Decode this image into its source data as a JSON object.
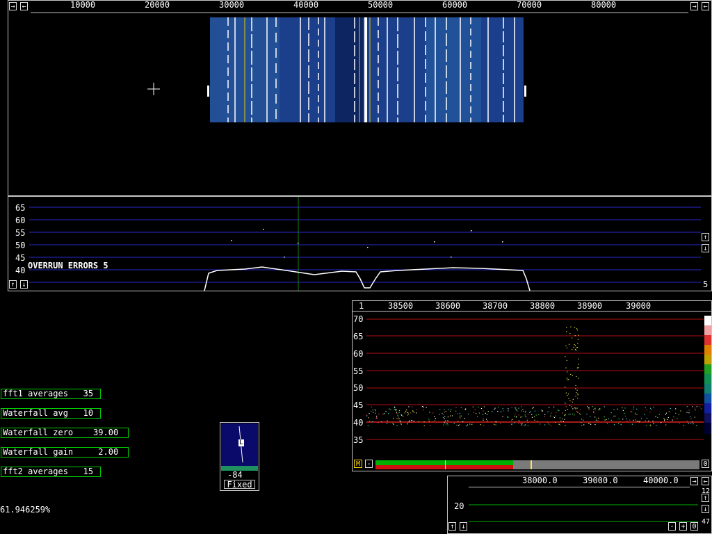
{
  "top_axis": {
    "ticks": [
      "10000",
      "20000",
      "30000",
      "40000",
      "50000",
      "60000",
      "70000",
      "80000"
    ],
    "left_btn_a": "→",
    "left_btn_b": "←",
    "right_btn_a": "→",
    "right_btn_b": "←"
  },
  "spectrum": {
    "y_labels": [
      "65",
      "60",
      "55",
      "50",
      "45",
      "40"
    ],
    "overrun_text": "OVERRUN ERRORS 5",
    "right_value": "5",
    "up_btn": "↑",
    "down_btn": "↓"
  },
  "zoom": {
    "x_ticks": [
      "38500",
      "38600",
      "38700",
      "38800",
      "38900",
      "39000"
    ],
    "left_label": "1",
    "y_labels": [
      "70",
      "65",
      "60",
      "55",
      "50",
      "45",
      "40",
      "35"
    ],
    "m_btn": "M",
    "minus_btn": "-",
    "zero_btn": "0"
  },
  "params": [
    {
      "label": "fft1 averages   35"
    },
    {
      "label": "Waterfall avg   10"
    },
    {
      "label": "Waterfall zero    39.00"
    },
    {
      "label": "Waterfall gain     2.00"
    },
    {
      "label": "fft2 averages   15"
    }
  ],
  "percent": "61.946259%",
  "smeter": {
    "value": "-84",
    "mode": "Fixed",
    "marker": "L"
  },
  "bottom_panel": {
    "x_ticks": [
      "38000.0",
      "39000.0",
      "40000.0"
    ],
    "y_label": "20",
    "right_top": "12",
    "right_bottom": "47",
    "btn_minus": "-",
    "btn_plus": "+",
    "btn_zero": "0",
    "up_btn": "↑",
    "down_btn": "↓",
    "right_btn": "→",
    "left_btn": "←"
  },
  "colors": {
    "grid_blue": "#2a2ad0",
    "grid_red": "#b01010",
    "grid_green": "#00b000",
    "waterfall_bg": "#1b3f8a"
  }
}
